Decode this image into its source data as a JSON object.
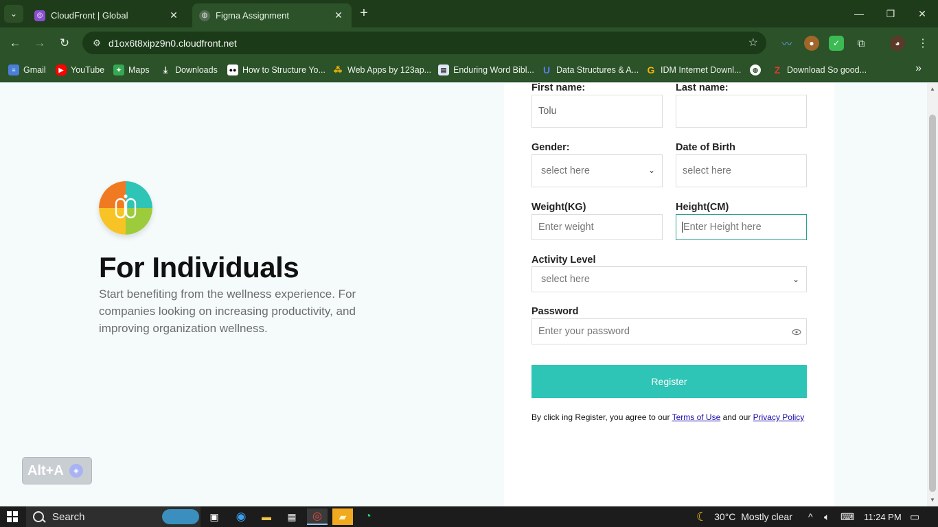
{
  "browser": {
    "tabs": [
      {
        "title": "CloudFront | Global",
        "favicon": "cloudfront-icon",
        "active": false
      },
      {
        "title": "Figma Assignment",
        "favicon": "globe-icon",
        "active": true
      }
    ],
    "url": "d1ox6t8xipz9n0.cloudfront.net",
    "bookmarks": [
      {
        "label": "Gmail",
        "icon": "gmail-icon"
      },
      {
        "label": "YouTube",
        "icon": "youtube-icon"
      },
      {
        "label": "Maps",
        "icon": "maps-icon"
      },
      {
        "label": "Downloads",
        "icon": "download-icon"
      },
      {
        "label": "How to Structure Yo...",
        "icon": "medium-icon"
      },
      {
        "label": "Web Apps by 123ap...",
        "icon": "webapps-icon"
      },
      {
        "label": "Enduring Word Bibl...",
        "icon": "book-icon"
      },
      {
        "label": "Data Structures & A...",
        "icon": "udemy-icon"
      },
      {
        "label": "IDM Internet Downl...",
        "icon": "google-icon"
      },
      {
        "label": "",
        "icon": "globe-icon"
      },
      {
        "label": "Download So good...",
        "icon": "z-icon"
      }
    ]
  },
  "hero": {
    "title": "For Individuals",
    "text": "Start benefiting from the wellness experience. For companies looking on increasing productivity, and improving organization wellness."
  },
  "alt_badge": {
    "label": "Alt+A"
  },
  "form": {
    "first_name": {
      "label": "First name:",
      "value": "Tolu"
    },
    "last_name": {
      "label": "Last name:",
      "value": ""
    },
    "gender": {
      "label": "Gender:",
      "value": "select here"
    },
    "dob": {
      "label": "Date of Birth",
      "placeholder": "select here"
    },
    "weight": {
      "label": "Weight(KG)",
      "placeholder": "Enter weight"
    },
    "height": {
      "label": "Height(CM)",
      "placeholder": "Enter Height here"
    },
    "activity": {
      "label": "Activity Level",
      "value": "select here"
    },
    "password": {
      "label": "Password",
      "placeholder": "Enter your password"
    },
    "register_label": "Register",
    "terms_prefix": "By click ing Register, you agree to our ",
    "terms_link": "Terms of Use",
    "terms_mid": " and our ",
    "privacy_link": "Privacy Policy",
    "accent_color": "#2ec4b6"
  },
  "taskbar": {
    "search": "Search",
    "weather": "30°C  Mostly clear",
    "time": "11:24 PM"
  }
}
